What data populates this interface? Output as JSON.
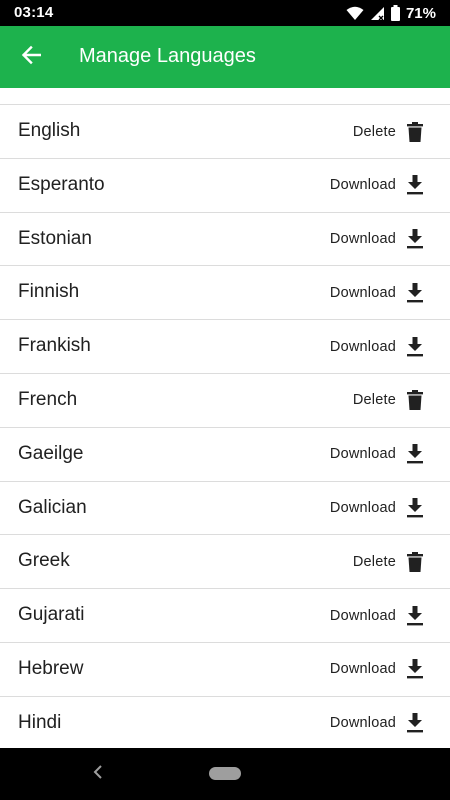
{
  "status_bar": {
    "time": "03:14",
    "battery_percent": "71%",
    "icons": [
      "wifi-icon",
      "signal-icon",
      "battery-icon"
    ]
  },
  "app_bar": {
    "title": "Manage Languages",
    "back_icon": "arrow-back-icon",
    "background_color": "#1db24d"
  },
  "languages": [
    {
      "name": "English",
      "action": "Delete",
      "icon": "trash-icon"
    },
    {
      "name": "Esperanto",
      "action": "Download",
      "icon": "download-icon"
    },
    {
      "name": "Estonian",
      "action": "Download",
      "icon": "download-icon"
    },
    {
      "name": "Finnish",
      "action": "Download",
      "icon": "download-icon"
    },
    {
      "name": "Frankish",
      "action": "Download",
      "icon": "download-icon"
    },
    {
      "name": "French",
      "action": "Delete",
      "icon": "trash-icon"
    },
    {
      "name": "Gaeilge",
      "action": "Download",
      "icon": "download-icon"
    },
    {
      "name": "Galician",
      "action": "Download",
      "icon": "download-icon"
    },
    {
      "name": "Greek",
      "action": "Delete",
      "icon": "trash-icon"
    },
    {
      "name": "Gujarati",
      "action": "Download",
      "icon": "download-icon"
    },
    {
      "name": "Hebrew",
      "action": "Download",
      "icon": "download-icon"
    },
    {
      "name": "Hindi",
      "action": "Download",
      "icon": "download-icon"
    }
  ],
  "nav_bar": {
    "back_icon": "nav-back-icon",
    "home_icon": "nav-home-pill-icon"
  }
}
